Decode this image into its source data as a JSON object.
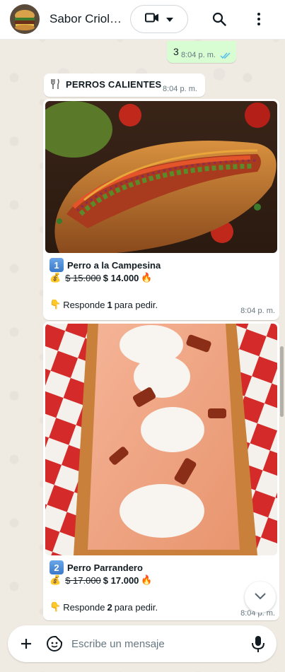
{
  "colors": {
    "header_bg": "#ffffff",
    "chat_bg": "#efeae2",
    "outgoing_bubble": "#d9fdd3",
    "incoming_bubble": "#ffffff",
    "read_ticks": "#53bdeb",
    "meta_text": "#667781"
  },
  "header": {
    "chat_name": "Sabor Criol…",
    "icons": [
      "restaurant-avatar",
      "video-call-icon",
      "chevron-down-icon",
      "search-icon",
      "more-vert-icon"
    ]
  },
  "messages": {
    "outgoing_number": {
      "text": "3",
      "time": "8:04 p. m.",
      "status": "read"
    },
    "section_title": {
      "emoji": "🍴",
      "text": "PERROS CALIENTES",
      "time": "8:04 p. m."
    },
    "items": [
      {
        "badge": "1",
        "name": "Perro a la Campesina",
        "old_price": "$ 15.000",
        "price": "$ 14.000",
        "fire": "🔥",
        "money": "💰",
        "reply_prefix": "Responde ",
        "reply_number": "1",
        "reply_suffix": " para pedir.",
        "pointer": "👇",
        "time": "8:04 p. m."
      },
      {
        "badge": "2",
        "name": "Perro Parrandero",
        "old_price": "$ 17.000",
        "price": "$ 17.000",
        "fire": "🔥",
        "money": "💰",
        "reply_prefix": "Responde ",
        "reply_number": "2",
        "reply_suffix": " para pedir.",
        "pointer": "👇",
        "time": "8:04 p. m."
      }
    ]
  },
  "composer": {
    "placeholder": "Escribe un mensaje",
    "value": ""
  }
}
